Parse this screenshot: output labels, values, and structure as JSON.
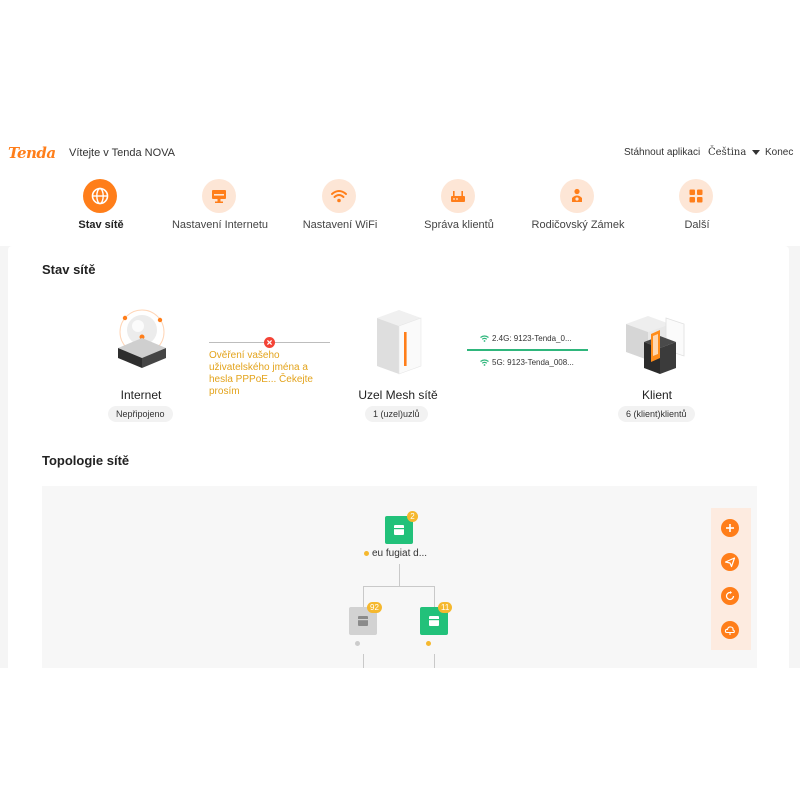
{
  "header": {
    "logo": "Tenda",
    "welcome": "Vítejte v Tenda NOVA",
    "download_app": "Stáhnout aplikaci",
    "language": "Čeština",
    "logout": "Konec"
  },
  "nav": {
    "items": [
      {
        "label": "Stav sítě",
        "icon": "globe-icon"
      },
      {
        "label": "Nastavení Internetu",
        "icon": "monitor-icon"
      },
      {
        "label": "Nastavení WiFi",
        "icon": "wifi-icon"
      },
      {
        "label": "Správa klientů",
        "icon": "router-icon"
      },
      {
        "label": "Rodičovský Zámek",
        "icon": "parent-icon"
      },
      {
        "label": "Další",
        "icon": "grid-icon"
      }
    ]
  },
  "status": {
    "title": "Stav sítě",
    "internet": {
      "label": "Internet",
      "status": "Nepřipojeno"
    },
    "error_message": "Ověření vašeho uživatelského jména a hesla PPPoE... Čekejte prosím",
    "mesh": {
      "label": "Uzel Mesh sítě",
      "count": "1 (uzel)uzlů"
    },
    "wifi": {
      "band_24": "2.4G: 9123-Tenda_0...",
      "band_5": "5G: 9123-Tenda_008..."
    },
    "client": {
      "label": "Klient",
      "count": "6 (klient)klientů"
    }
  },
  "topology": {
    "title": "Topologie sítě",
    "root": {
      "name": "eu fugiat d...",
      "badge": "2"
    },
    "children": [
      {
        "badge": "92",
        "online": false
      },
      {
        "badge": "11",
        "online": true
      }
    ],
    "tools": [
      "plus-icon",
      "send-icon",
      "refresh-icon",
      "cloud-icon"
    ]
  },
  "colors": {
    "accent": "#ff7e1a",
    "accent_light": "#fde6d6",
    "error_red": "#f44336",
    "warning_text": "#e3a31b",
    "wifi_green": "#2fb67c",
    "node_green": "#22c17a",
    "node_gray": "#d2d2d2",
    "badge": "#f5b82e"
  }
}
